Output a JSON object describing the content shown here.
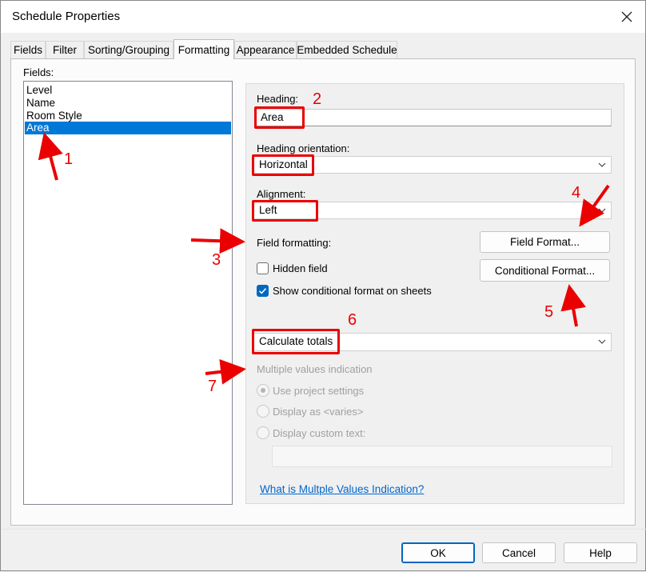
{
  "window": {
    "title": "Schedule Properties"
  },
  "tabs": [
    "Fields",
    "Filter",
    "Sorting/Grouping",
    "Formatting",
    "Appearance",
    "Embedded Schedule"
  ],
  "fields": {
    "label": "Fields:",
    "items": [
      "Level",
      "Name",
      "Room Style",
      "Area"
    ],
    "selected": "Area"
  },
  "formatting": {
    "heading_label": "Heading:",
    "heading_value": "Area",
    "heading_orientation_label": "Heading orientation:",
    "heading_orientation_value": "Horizontal",
    "alignment_label": "Alignment:",
    "alignment_value": "Left",
    "field_formatting_label": "Field formatting:",
    "field_format_button": "Field Format...",
    "conditional_format_button": "Conditional  Format...",
    "hidden_field_label": "Hidden field",
    "hidden_field_checked": false,
    "show_conditional_label": "Show conditional format on sheets",
    "show_conditional_checked": true,
    "totals_value": "Calculate totals",
    "multiple_values_label": "Multiple values indication",
    "radio_use_project": "Use project settings",
    "radio_display_varies": "Display as <varies>",
    "radio_display_custom": "Display custom text:",
    "custom_text_value": "",
    "help_link": "What is Multple Values Indication?"
  },
  "footer": {
    "ok": "OK",
    "cancel": "Cancel",
    "help": "Help"
  },
  "annotations": [
    "1",
    "2",
    "3",
    "4",
    "5",
    "6",
    "7"
  ],
  "colors": {
    "accent": "#0078d7",
    "annotation_red": "#ea0000",
    "link": "#0066cc"
  }
}
